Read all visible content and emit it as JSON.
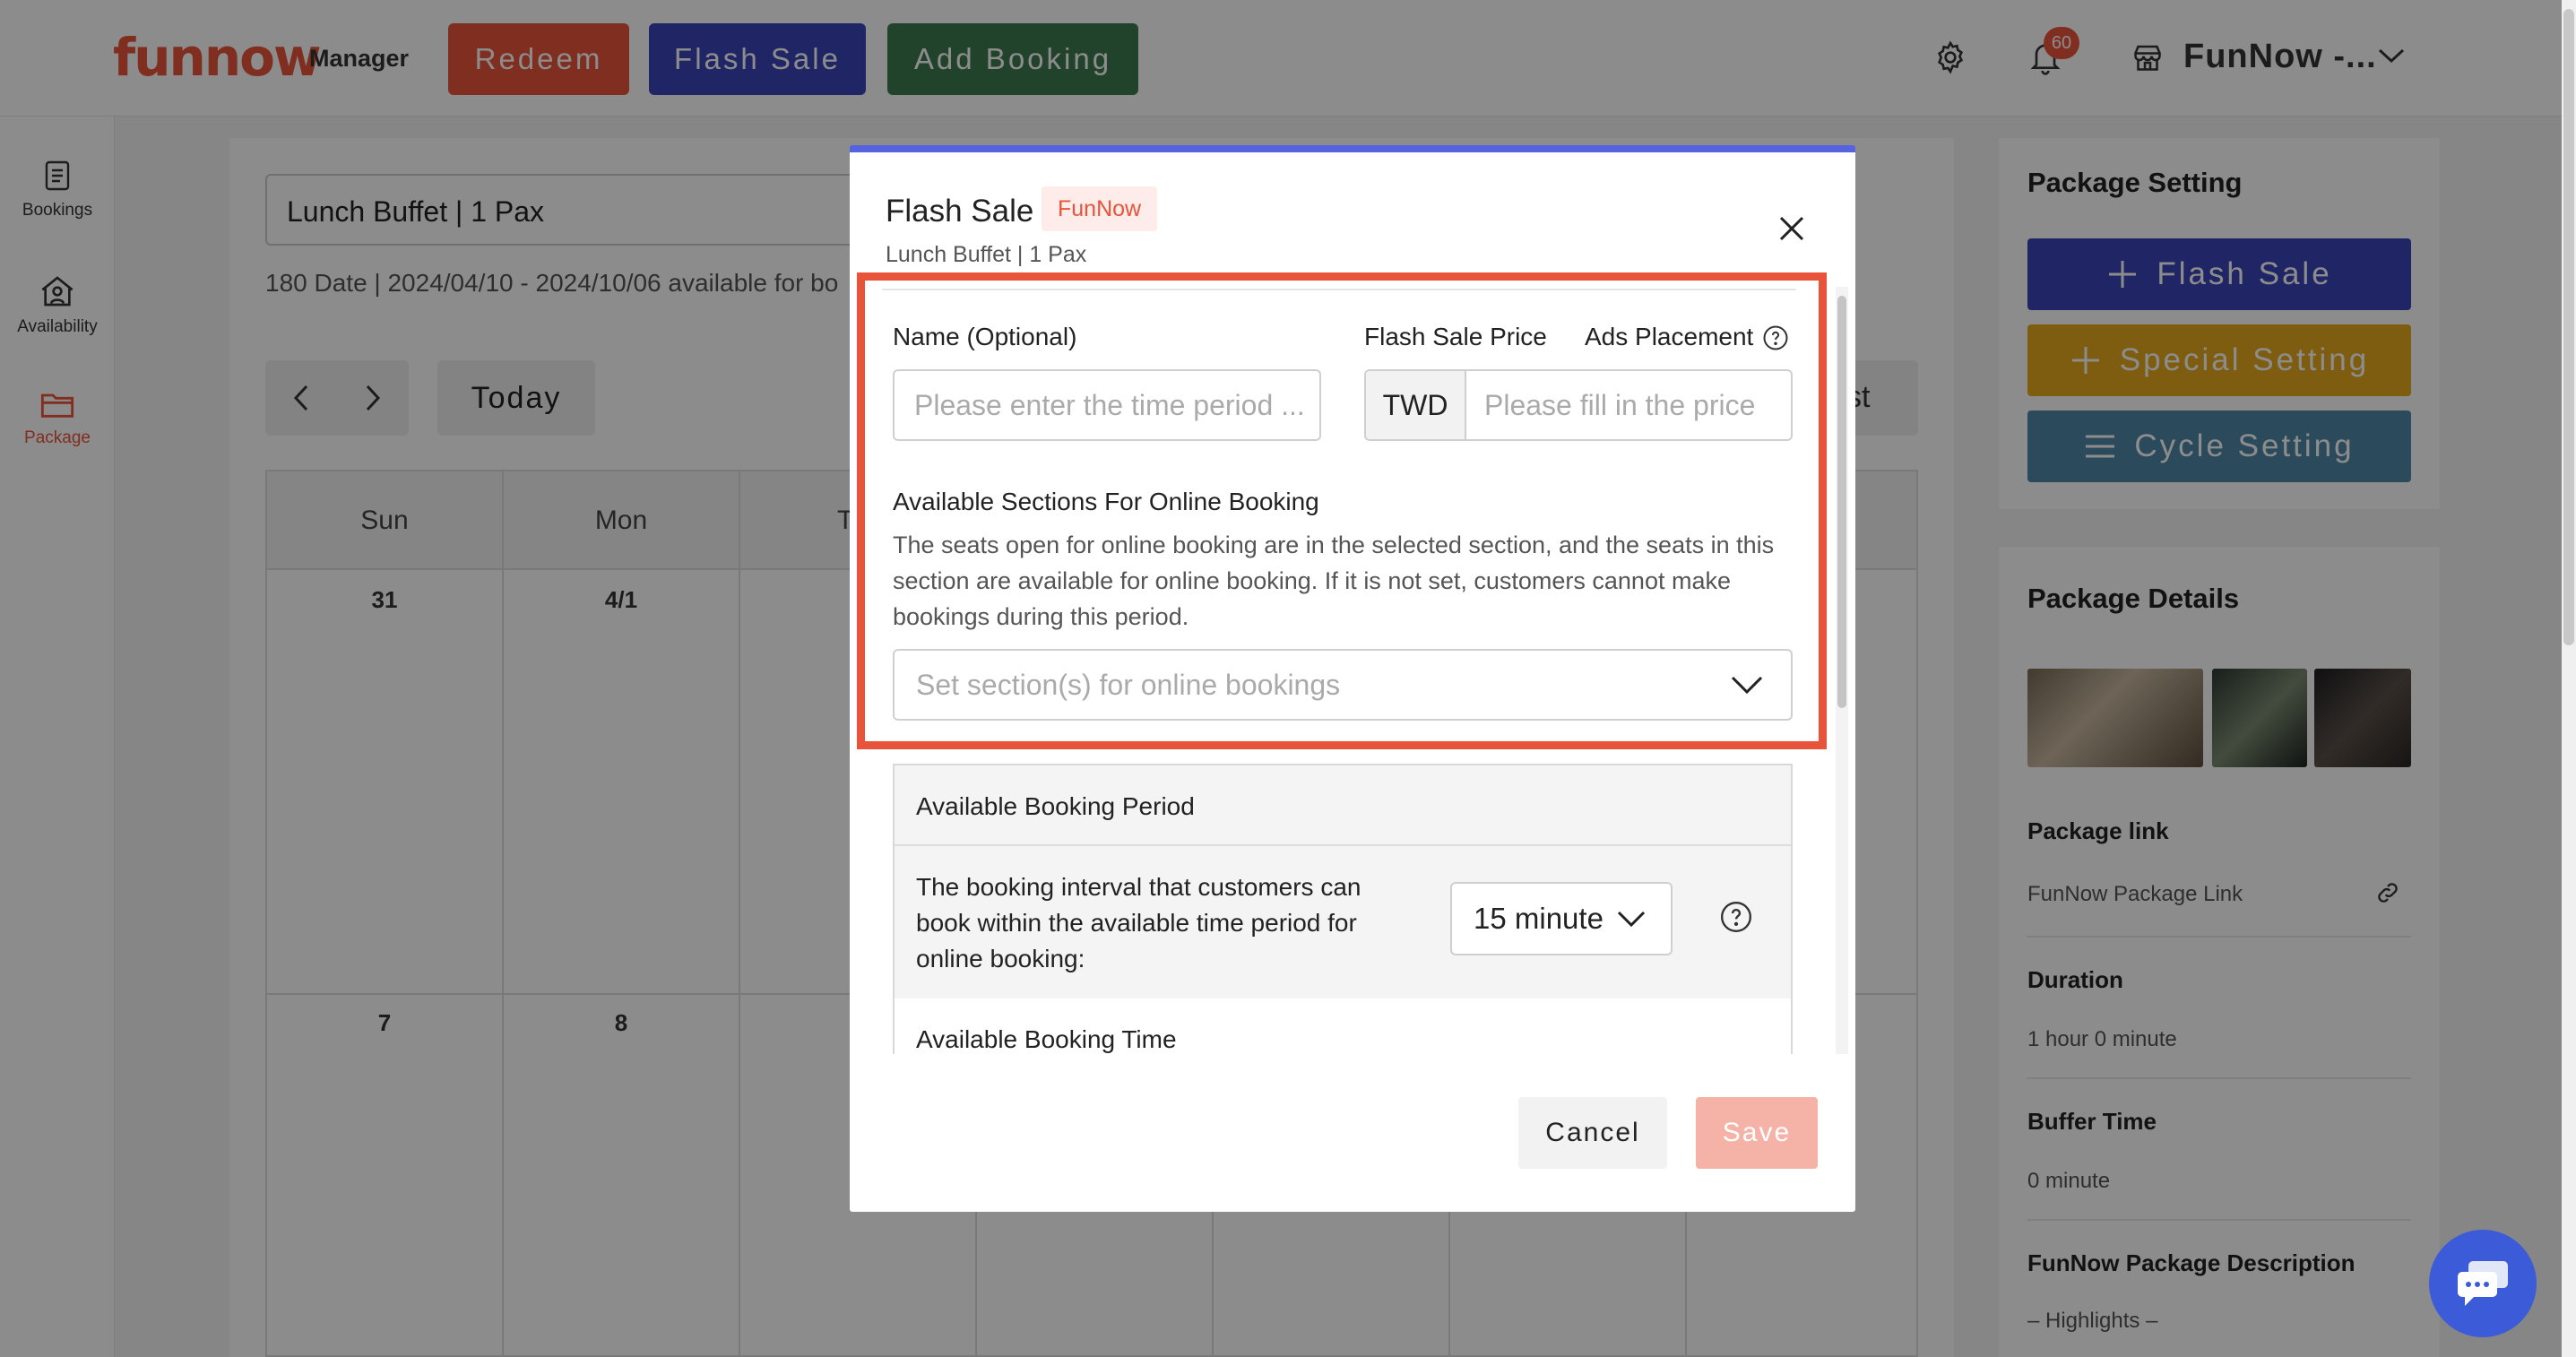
{
  "header": {
    "logo": "funnow",
    "logo_sub": "Manager",
    "buttons": {
      "redeem": "Redeem",
      "flash_sale": "Flash Sale",
      "add_booking": "Add Booking"
    },
    "notification_count": "60",
    "store_name": "FunNow -..."
  },
  "sidebar": {
    "items": [
      {
        "label": "Bookings",
        "icon": "document-icon"
      },
      {
        "label": "Availability",
        "icon": "home-person-icon"
      },
      {
        "label": "Package",
        "icon": "folder-icon",
        "active": true
      }
    ]
  },
  "main": {
    "package_select": "Lunch Buffet | 1 Pax",
    "date_info": "180 Date | 2024/04/10 - 2024/10/06 available for bo",
    "today": "Today",
    "view_label": "st",
    "day_names": [
      "Sun",
      "Mon",
      "T"
    ],
    "week_dates": [
      [
        "31",
        "4/1"
      ],
      [
        "7",
        "8"
      ]
    ]
  },
  "right_panel": {
    "setting_title": "Package Setting",
    "buttons": {
      "flash_sale": "Flash Sale",
      "special_setting": "Special Setting",
      "cycle_setting": "Cycle Setting"
    },
    "details_title": "Package Details",
    "package_link_label": "Package link",
    "package_link_value": "FunNow Package Link",
    "duration_label": "Duration",
    "duration_value": "1 hour 0 minute",
    "buffer_label": "Buffer Time",
    "buffer_value": "0 minute",
    "description_label": "FunNow Package Description",
    "description_value": "– Highlights –"
  },
  "modal": {
    "title": "Flash Sale",
    "tag": "FunNow",
    "subtitle": "Lunch Buffet | 1 Pax",
    "name_label": "Name (Optional)",
    "name_placeholder": "Please enter the time period ...",
    "price_label": "Flash Sale Price",
    "ads_label": "Ads Placement",
    "currency": "TWD",
    "price_placeholder": "Please fill in the price",
    "sections_label": "Available Sections For Online Booking",
    "sections_desc": "The seats open for online booking are in the selected section, and the seats in this section are available for online booking. If it is not set, customers cannot make bookings during this period.",
    "sections_placeholder": "Set section(s) for online bookings",
    "period_title": "Available Booking Period",
    "interval_text": "The booking interval that customers can book within the available time period for online booking:",
    "interval_value": "15 minute",
    "booking_time_label": "Available Booking Time",
    "cancel": "Cancel",
    "save": "Save"
  },
  "colors": {
    "brand": "#e8543a",
    "flash_blue": "#3b46b8",
    "add_green": "#3c7a4f",
    "special_gold": "#e6a91e",
    "cycle_steel": "#4f87a8",
    "highlight": "#e8543a"
  }
}
